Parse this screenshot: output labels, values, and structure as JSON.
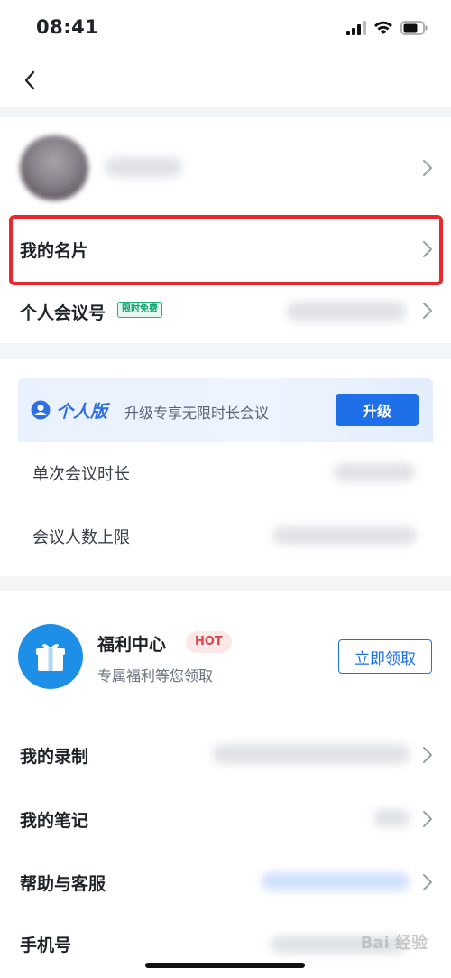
{
  "status_bar": {
    "time": "08:41"
  },
  "profile": {
    "items": [
      {
        "label": "我的名片"
      },
      {
        "label": "个人会议号",
        "tag": "限时免费"
      }
    ]
  },
  "plan": {
    "title": "个人版",
    "description": "升级专享无限时长会议",
    "upgrade_label": "升级",
    "rows": [
      {
        "label": "单次会议时长"
      },
      {
        "label": "会议人数上限"
      }
    ]
  },
  "welfare": {
    "title": "福利中心",
    "badge": "HOT",
    "subtitle": "专属福利等您领取",
    "claim_label": "立即领取"
  },
  "menu": {
    "items": [
      {
        "label": "我的录制"
      },
      {
        "label": "我的笔记"
      },
      {
        "label": "帮助与客服"
      },
      {
        "label": "手机号"
      }
    ]
  },
  "watermark": "Bai 经验",
  "colors": {
    "accent": "#1e6fe8",
    "highlight": "#e8282b",
    "free_tag": "#14a06e",
    "hot": "#e0454b"
  }
}
